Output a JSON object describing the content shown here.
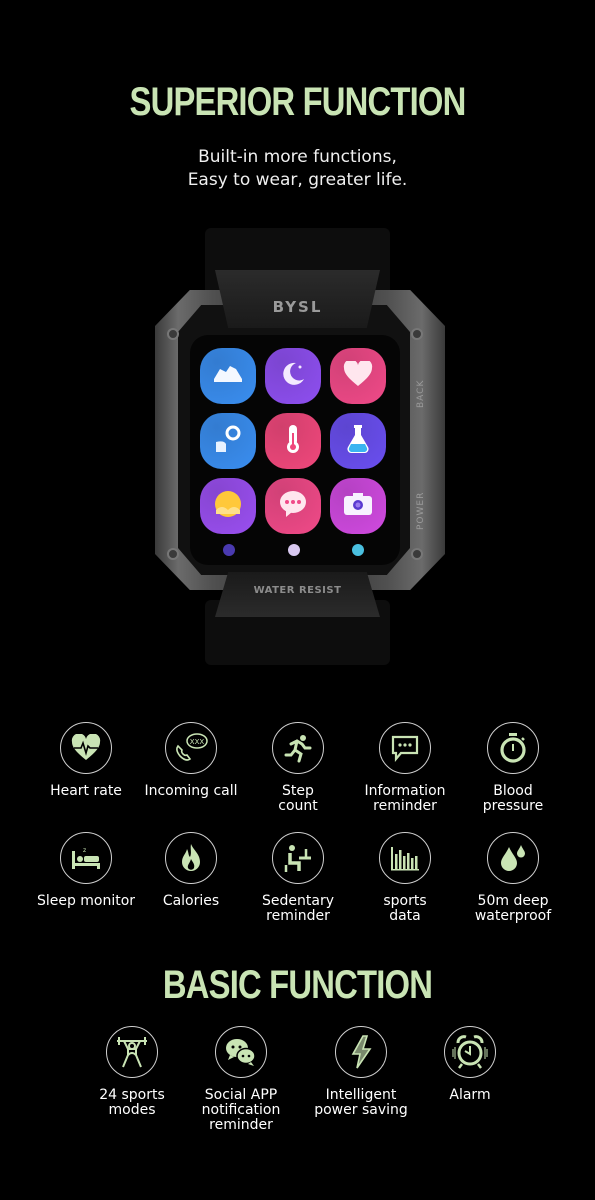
{
  "header": {
    "title": "SUPERIOR FUNCTION",
    "subtitle_line1": "Built-in more functions,",
    "subtitle_line2": "Easy to wear, greater life."
  },
  "watch": {
    "brand": "BYSL",
    "bottom_label": "WATER RESIST",
    "side_button_top": "BACK",
    "side_button_bottom": "POWER",
    "apps": [
      {
        "name": "sneaker-icon",
        "color": "#3a8ef0"
      },
      {
        "name": "moon-icon",
        "color": "#8e4ff0"
      },
      {
        "name": "heart-icon",
        "color": "#f04a88"
      },
      {
        "name": "dumbbell-arm-icon",
        "color": "#3a8ef0"
      },
      {
        "name": "thermometer-icon",
        "color": "#f0487c"
      },
      {
        "name": "flask-icon",
        "color": "#6a4ff0"
      },
      {
        "name": "photos-icon",
        "color": "#9a4ff0"
      },
      {
        "name": "message-icon",
        "color": "#f04a88"
      },
      {
        "name": "camera-icon",
        "color": "#d04ae0"
      }
    ],
    "dock": [
      "compass-icon",
      "sparkle-icon",
      "clock-icon"
    ]
  },
  "superior_features": [
    {
      "icon": "heart-rate-icon",
      "label": "Heart rate"
    },
    {
      "icon": "incoming-call-icon",
      "label": "Incoming call"
    },
    {
      "icon": "running-icon",
      "label": "Step\ncount"
    },
    {
      "icon": "message-icon",
      "label": "Information\nreminder"
    },
    {
      "icon": "stopwatch-icon",
      "label": "Blood\npressure"
    },
    {
      "icon": "sleep-bed-icon",
      "label": "Sleep monitor"
    },
    {
      "icon": "flame-icon",
      "label": "Calories"
    },
    {
      "icon": "sitting-icon",
      "label": "Sedentary\nreminder"
    },
    {
      "icon": "bar-chart-icon",
      "label": "sports\ndata"
    },
    {
      "icon": "water-drop-icon",
      "label": "50m deep\nwaterproof"
    }
  ],
  "basic_title": "BASIC FUNCTION",
  "basic_features": [
    {
      "icon": "weightlifting-icon",
      "label": "24 sports\nmodes"
    },
    {
      "icon": "chat-bubbles-icon",
      "label": "Social APP\nnotification\nreminder"
    },
    {
      "icon": "lightning-icon",
      "label": "Intelligent\npower saving"
    },
    {
      "icon": "alarm-clock-icon",
      "label": "Alarm"
    }
  ],
  "colors": {
    "accent": "#c9e4b4",
    "background": "#000000"
  }
}
